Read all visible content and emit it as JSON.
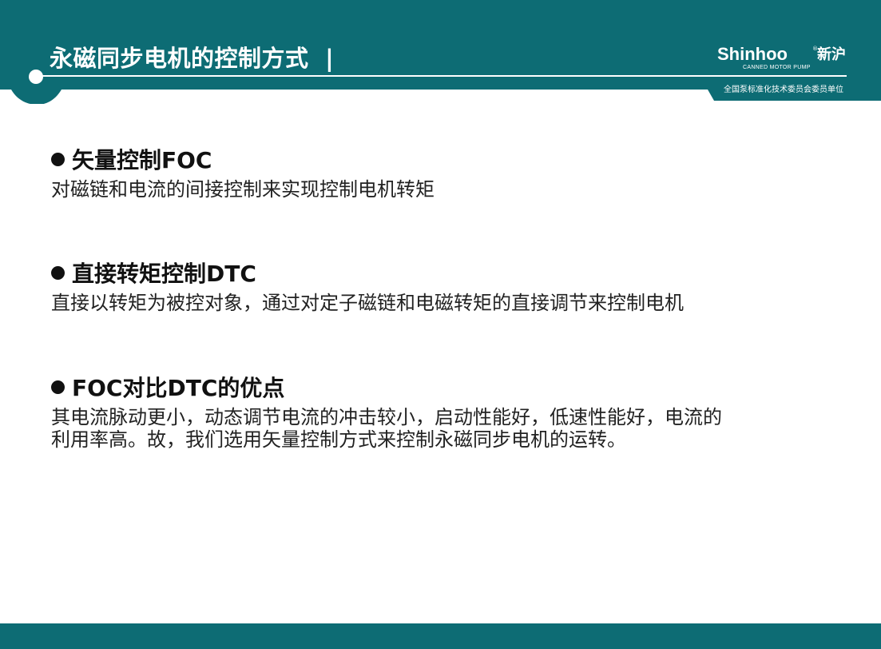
{
  "header": {
    "title": "永磁同步电机的控制方式",
    "separator": "|",
    "brand_name": "Shinhoo",
    "brand_reg": "®",
    "brand_cn": "新沪",
    "brand_sub": "CANNED MOTOR PUMP",
    "committee_text": "全国泵标准化技术委员会委员单位"
  },
  "colors": {
    "theme_teal": "#0d6c74",
    "text_dark": "#111111"
  },
  "sections": [
    {
      "heading": "矢量控制FOC",
      "lines": [
        "对磁链和电流的间接控制来实现控制电机转矩"
      ]
    },
    {
      "heading": "直接转矩控制DTC",
      "lines": [
        "直接以转矩为被控对象，通过对定子磁链和电磁转矩的直接调节来控制电机"
      ]
    },
    {
      "heading": "FOC对比DTC的优点",
      "lines": [
        "其电流脉动更小，动态调节电流的冲击较小，启动性能好，低速性能好，电流的",
        "利用率高。故，我们选用矢量控制方式来控制永磁同步电机的运转。"
      ]
    }
  ]
}
